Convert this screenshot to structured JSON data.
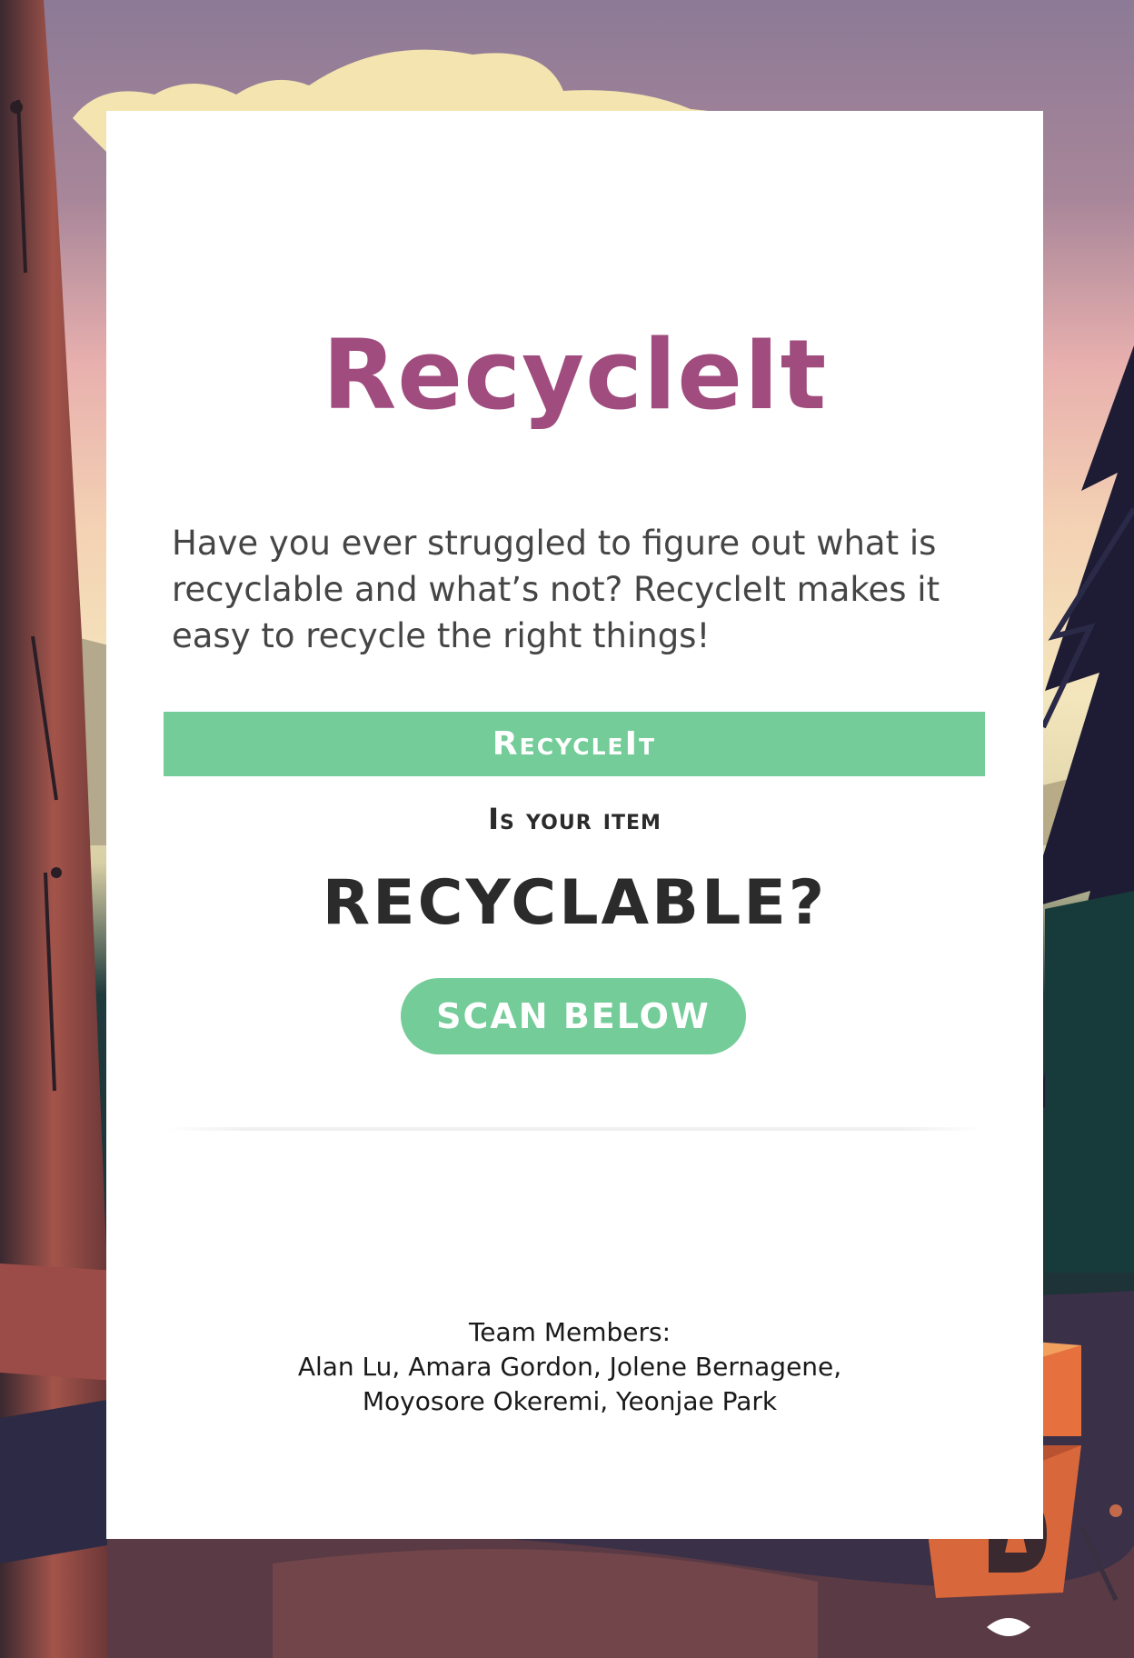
{
  "card": {
    "title": "RecycleIt",
    "intro": "Have you ever struggled to figure out what is recyclable and what’s not? RecycleIt makes it easy to recycle the right things!",
    "banner_label": "RecycleIt",
    "question": "Is your item",
    "headline": "RECYCLABLE?",
    "scan_button": "SCAN BELOW",
    "team_heading": "Team Members:",
    "team_line_1": "Alan Lu, Amara Gordon, Jolene Bernagene,",
    "team_line_2": "Moyosore Okeremi, Yeonjae Park"
  },
  "colors": {
    "title": "#a04c7e",
    "accent_green": "#74cc99",
    "text_dark": "#2b2b2b"
  },
  "icons": [
    "tree-trunk-icon",
    "pine-tree-icon",
    "cloud-icon",
    "robot-mascot-icon",
    "dartmouth-d-logo-icon"
  ]
}
